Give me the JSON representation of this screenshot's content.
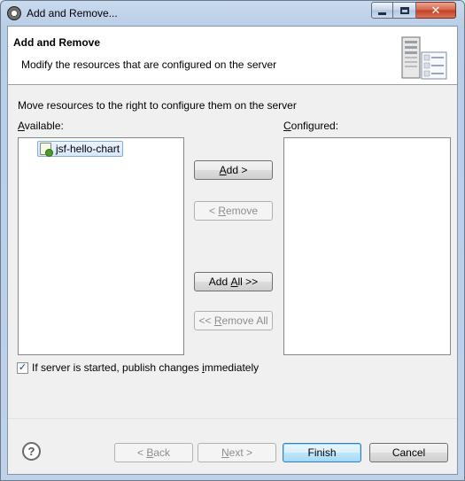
{
  "window": {
    "title": "Add and Remove..."
  },
  "banner": {
    "title": "Add and Remove",
    "message": "Modify the resources that are configured on the server",
    "icon": "server-icon"
  },
  "instruction": "Move resources to the right to configure them on the server",
  "available": {
    "label_prefix": "",
    "label_mnemonic": "A",
    "label_rest": "vailable:",
    "items": [
      {
        "label": "jsf-hello-chart",
        "icon": "web-project-icon",
        "selected": true
      }
    ]
  },
  "configured": {
    "label_mnemonic": "C",
    "label_rest": "onfigured:",
    "items": []
  },
  "buttons": {
    "add": {
      "mnemonic": "A",
      "rest": "dd >",
      "enabled": true
    },
    "remove": {
      "prefix": "< ",
      "mnemonic": "R",
      "rest": "emove",
      "enabled": false
    },
    "add_all": {
      "prefix": "Add ",
      "mnemonic": "A",
      "rest": "ll >>",
      "enabled": true
    },
    "remove_all": {
      "prefix": "<< ",
      "mnemonic": "R",
      "rest": "emove All",
      "enabled": false
    }
  },
  "publish_checkbox": {
    "checked": true,
    "label_before": "If server is started, publish changes ",
    "label_mnemonic": "i",
    "label_after": "mmediately"
  },
  "footer": {
    "help_icon": "help-icon",
    "back": {
      "prefix": "< ",
      "mnemonic": "B",
      "rest": "ack",
      "enabled": false
    },
    "next": {
      "mnemonic": "N",
      "rest": "ext >",
      "enabled": false
    },
    "finish": {
      "label": "Finish",
      "enabled": true,
      "default": true
    },
    "cancel": {
      "label": "Cancel",
      "enabled": true
    }
  }
}
